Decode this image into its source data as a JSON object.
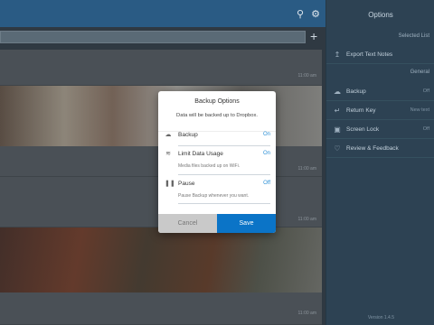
{
  "app": {
    "search_icon": "search-icon",
    "settings_icon": "gear-icon",
    "add_icon": "plus-icon",
    "times": [
      "11:00 am",
      "11:00 am",
      "11:00 am",
      "11:00 am"
    ]
  },
  "options_panel": {
    "title": "Options",
    "section_selected": "Selected List",
    "export_label": "Export Text Notes",
    "section_general": "General",
    "items": [
      {
        "label": "Backup",
        "value": "Off",
        "icon": "cloud-icon"
      },
      {
        "label": "Return Key",
        "value": "New text",
        "icon": "return-icon"
      },
      {
        "label": "Screen Lock",
        "value": "Off",
        "icon": "lock-icon"
      },
      {
        "label": "Review & Feedback",
        "value": "",
        "icon": "heart-icon"
      }
    ],
    "version": "Version 1.4.5"
  },
  "modal": {
    "title": "Backup Options",
    "subtitle": "Data will be backed up to Dropbox.",
    "rows": [
      {
        "label": "Backup",
        "value": "On",
        "description": "",
        "icon": "cloud-icon"
      },
      {
        "label": "Limit Data Usage",
        "value": "On",
        "description": "Media files backed up on WiFi.",
        "icon": "wifi-icon"
      },
      {
        "label": "Pause",
        "value": "Off",
        "description": "Pause Backup whenever you want.",
        "icon": "pause-icon"
      }
    ],
    "cancel_label": "Cancel",
    "save_label": "Save"
  },
  "colors": {
    "accent": "#0b74c7",
    "value_blue": "#2b8fd6",
    "panel_bg": "#2d4253"
  }
}
